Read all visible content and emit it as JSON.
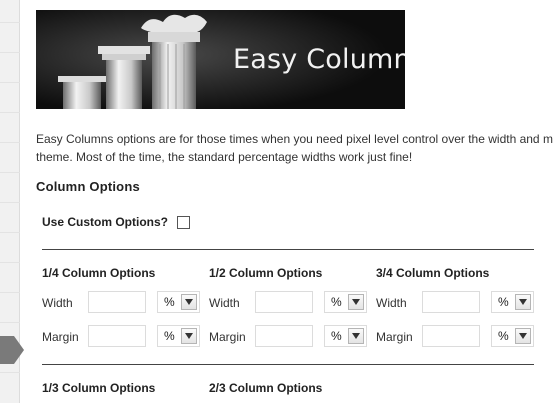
{
  "banner": {
    "title": "Easy Columns"
  },
  "intro": {
    "line1": "Easy Columns options are for those times when you need pixel level control over the width and m",
    "line2": "theme. Most of the time, the standard percentage widths work just fine!"
  },
  "section": {
    "title": "Column Options"
  },
  "custom": {
    "label": "Use Custom Options?",
    "checked": false
  },
  "groups": [
    {
      "title": "1/4 Column Options",
      "width_label": "Width",
      "width_value": "",
      "width_unit": "%",
      "margin_label": "Margin",
      "margin_value": "",
      "margin_unit": "%"
    },
    {
      "title": "1/2 Column Options",
      "width_label": "Width",
      "width_value": "",
      "width_unit": "%",
      "margin_label": "Margin",
      "margin_value": "",
      "margin_unit": "%"
    },
    {
      "title": "3/4 Column Options",
      "width_label": "Width",
      "width_value": "",
      "width_unit": "%",
      "margin_label": "Margin",
      "margin_value": "",
      "margin_unit": "%"
    },
    {
      "title": "1/3 Column Options"
    },
    {
      "title": "2/3 Column Options"
    }
  ],
  "colors": {
    "banner_bg": "#0d0d0d",
    "divider": "#444444",
    "sidebar": "#f1f1f1",
    "pointer": "#7a7a7a"
  }
}
